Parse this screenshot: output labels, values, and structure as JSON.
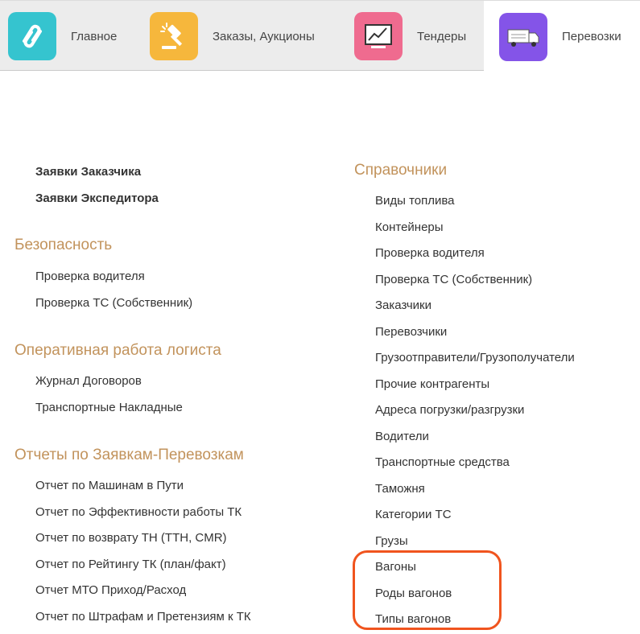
{
  "tabs": [
    {
      "label": "Главное",
      "icon": "chain-link-icon",
      "color": "#35c4cf"
    },
    {
      "label": "Заказы, Аукционы",
      "icon": "gavel-icon",
      "color": "#f6b73c"
    },
    {
      "label": "Тендеры",
      "icon": "chart-monitor-icon",
      "color": "#ef6b8f"
    },
    {
      "label": "Перевозки",
      "icon": "truck-icon",
      "color": "#8454e8",
      "active": true
    }
  ],
  "left": {
    "top_links": [
      "Заявки Заказчика",
      "Заявки Экспедитора"
    ],
    "security": {
      "title": "Безопасность",
      "items": [
        "Проверка водителя",
        "Проверка ТС (Собственник)"
      ]
    },
    "logistics": {
      "title": "Оперативная работа логиста",
      "items": [
        "Журнал Договоров",
        "Транспортные Накладные"
      ]
    },
    "reports": {
      "title": "Отчеты по Заявкам-Перевозкам",
      "items": [
        "Отчет по Машинам в Пути",
        "Отчет по Эффективности работы ТК",
        "Отчет по возврату ТН (ТТН, CMR)",
        "Отчет по Рейтингу ТК (план/факт)",
        "Отчет МТО Приход/Расход",
        "Отчет по Штрафам и Претензиям к ТК"
      ]
    }
  },
  "right": {
    "title": "Справочники",
    "items": [
      "Виды топлива",
      "Контейнеры",
      "Проверка водителя",
      "Проверка ТС (Собственник)",
      "Заказчики",
      "Перевозчики",
      "Грузоотправители/Грузополучатели",
      "Прочие контрагенты",
      "Адреса погрузки/разгрузки",
      "Водители",
      "Транспортные средства",
      "Таможня",
      "Категории ТС",
      "Грузы",
      "Вагоны",
      "Роды вагонов",
      "Типы вагонов"
    ]
  },
  "colors": {
    "section_heading": "#c2935c",
    "highlight": "#f0541e",
    "topbar_bg": "#ececec"
  }
}
